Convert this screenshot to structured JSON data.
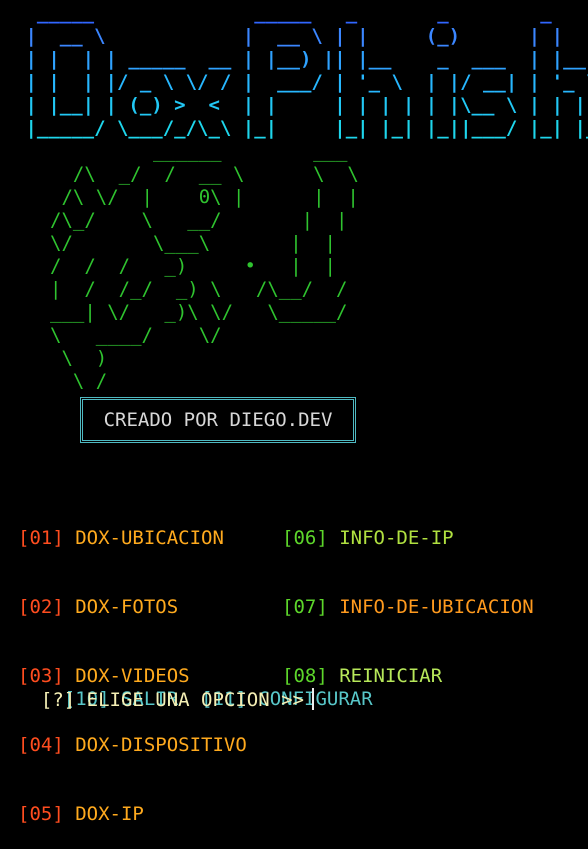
{
  "banner": {
    "lines": [
      "  _____              _____   _       _        _    ",
      " |  __ \\            |  __ \\ | |     (_)      | |   ",
      " | |  | | _____  __ | |__) || |__    _  ___  | |__ ",
      " | |  | |/ _ \\ \\/ / |  ___/ | '_ \\  | |/ __| | '_ \\",
      " | |__| | (_) >  <  | |     | | | | | |\\__ \\ | | | |",
      " |_____/ \\___/_/\\_\\ |_|     |_| |_| |_||___/ |_| |_|"
    ]
  },
  "art": {
    "text": "         ______        ___\n  /\\  _/  /  __ \\      \\  \\\n /\\ \\/  |    0\\ |      |  |\n/\\_/    \\   __/       |  |\n\\/       \\___\\       |  |\n/  /  /   _)     •   |  |\n|  /  /_/  _) \\   /\\__/  /\n___| \\/   _)\\ \\/   \\_____/\n\\   ____/    \\/\n \\  )\n  \\ /"
  },
  "credit": {
    "label": "CREADO POR DIEGO.DEV"
  },
  "menu_left": [
    {
      "num": "[01]",
      "label": "DOX-UBICACION"
    },
    {
      "num": "[02]",
      "label": "DOX-FOTOS"
    },
    {
      "num": "[03]",
      "label": "DOX-VIDEOS"
    },
    {
      "num": "[04]",
      "label": "DOX-DISPOSITIVO"
    },
    {
      "num": "[05]",
      "label": "DOX-IP"
    }
  ],
  "menu_right": [
    {
      "num": "[06]",
      "label": "INFO-DE-IP"
    },
    {
      "num": "[07]",
      "label": "INFO-DE-UBICACION"
    },
    {
      "num": "[08]",
      "label": "REINICIAR"
    }
  ],
  "menu_bottom": [
    {
      "num": "[10]",
      "label": "SALIR"
    },
    {
      "num": "[11]",
      "label": "CONFIGURAR"
    }
  ],
  "prompt": {
    "text": "[?] ELIGE UNA OPCION >>"
  },
  "colors": {
    "banner_gradient": [
      "#3a6bff",
      "#2aa6ff",
      "#21d3f5"
    ],
    "art": "#2fc32f",
    "menu_num_left": "#ff4d1f",
    "menu_label_left": "#ffaa1e",
    "menu_num_right": "#5dd62b",
    "menu_bottom": "#58c7c9"
  }
}
